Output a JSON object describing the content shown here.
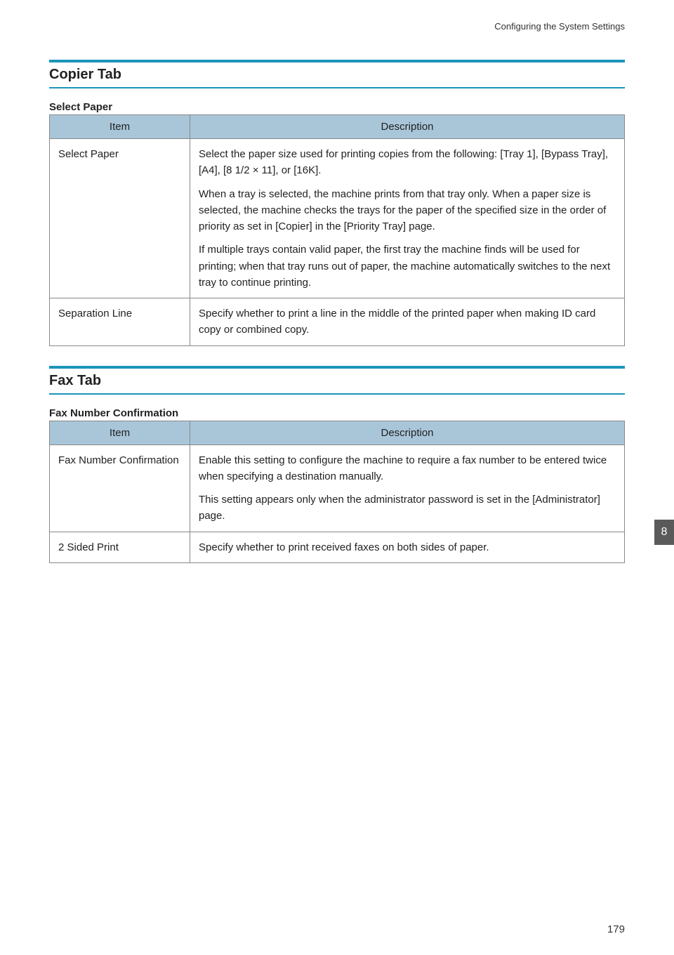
{
  "running_header": "Configuring the System Settings",
  "chapter_number": "8",
  "page_number": "179",
  "sections": [
    {
      "title": "Copier Tab",
      "subtitle": "Select Paper",
      "table": {
        "headers": {
          "item": "Item",
          "description": "Description"
        },
        "rows": [
          {
            "item": "Select Paper",
            "paragraphs": [
              "Select the paper size used for printing copies from the following: [Tray 1], [Bypass Tray], [A4], [8 1/2 × 11], or [16K].",
              "When a tray is selected, the machine prints from that tray only. When a paper size is selected, the machine checks the trays for the paper of the specified size in the order of priority as set in [Copier] in the [Priority Tray] page.",
              "If multiple trays contain valid paper, the first tray the machine finds will be used for printing; when that tray runs out of paper, the machine automatically switches to the next tray to continue printing."
            ]
          },
          {
            "item": "Separation Line",
            "paragraphs": [
              "Specify whether to print a line in the middle of the printed paper when making ID card copy or combined copy."
            ]
          }
        ]
      }
    },
    {
      "title": "Fax Tab",
      "subtitle": "Fax Number Confirmation",
      "table": {
        "headers": {
          "item": "Item",
          "description": "Description"
        },
        "rows": [
          {
            "item": "Fax Number Confirmation",
            "paragraphs": [
              "Enable this setting to configure the machine to require a fax number to be entered twice when specifying a destination manually.",
              "This setting appears only when the administrator password is set in the [Administrator] page."
            ]
          },
          {
            "item": "2 Sided Print",
            "paragraphs": [
              "Specify whether to print received faxes on both sides of paper."
            ]
          }
        ]
      }
    }
  ]
}
